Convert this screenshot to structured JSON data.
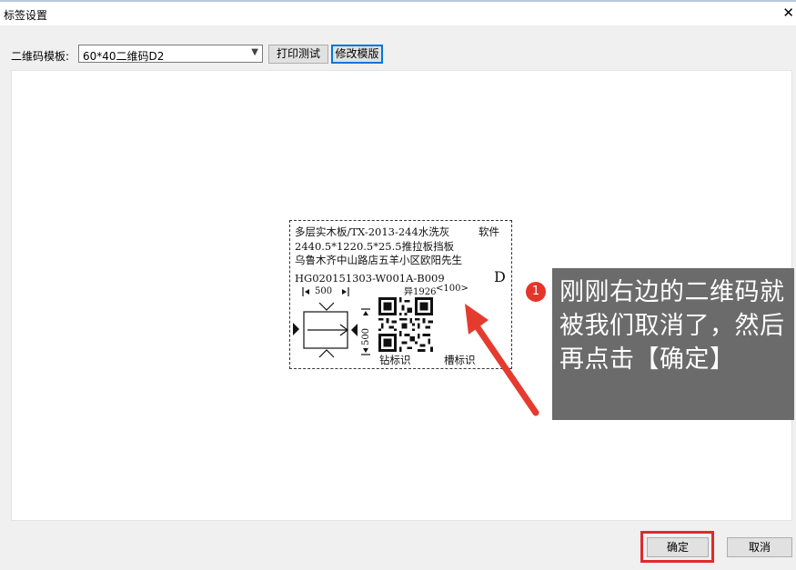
{
  "window": {
    "title": "标签设置",
    "close_glyph": "✕"
  },
  "toolbar": {
    "template_label": "二维码模板:",
    "template_value": "60*40二维码D2",
    "print_test": "打印测试",
    "edit_template": "修改模版"
  },
  "label": {
    "line1": "多层实木板/TX-2013-244水洗灰",
    "line1_tail": "软件",
    "line2": "2440.5*1220.5*25.5推拉板挡板",
    "line3": "乌鲁木齐中山路店五羊小区欧阳先生",
    "code": "HG020151303-W001A-B009",
    "side_letter": "D",
    "dim_top": "500",
    "dim_side": "500",
    "shape_code": "异1926",
    "qty": "<100>",
    "drill_label": "钻标识",
    "groove_label": "槽标识"
  },
  "callout": {
    "badge": "1",
    "text": "刚刚右边的二维码就被我们取消了，然后再点击【确定】"
  },
  "footer": {
    "ok": "确定",
    "cancel": "取消"
  },
  "colors": {
    "accent": "#e02a2a",
    "callout_bg": "#6b6b6b",
    "focus": "#0078d7"
  }
}
